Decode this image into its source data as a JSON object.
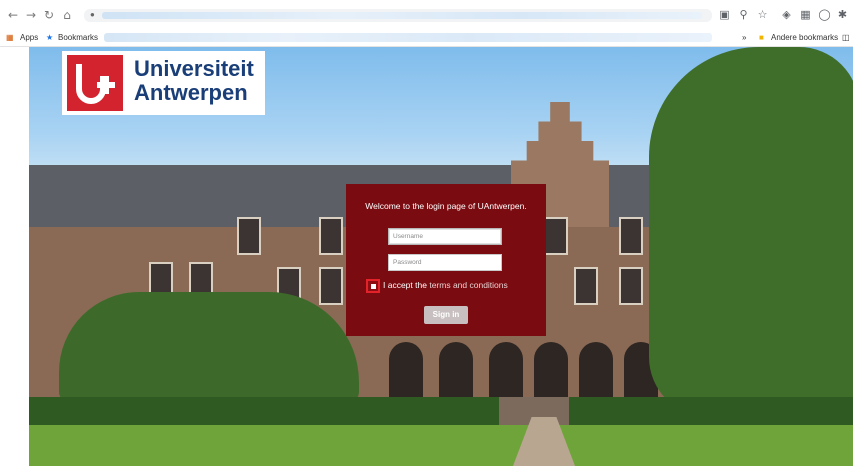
{
  "browser": {
    "nav_icons": [
      "back-icon",
      "forward-icon",
      "reload-icon",
      "home-icon"
    ],
    "lock_icon": "lock-icon"
  },
  "bookmarks_bar": {
    "apps_label": "Apps",
    "bookmarks_label": "Bookmarks",
    "other_bookmarks_label": "Andere bookmarks"
  },
  "logo": {
    "line1": "Universiteit",
    "line2": "Antwerpen",
    "brand_color": "#d2232e",
    "text_color": "#1a3e78"
  },
  "login": {
    "title": "Welcome to the login page of UAntwerpen.",
    "username_placeholder": "Username",
    "password_placeholder": "Password",
    "accept_prefix": "I accept the",
    "terms_link": "terms and conditions",
    "signin_label": "Sign in",
    "panel_color": "#7a0b10"
  }
}
